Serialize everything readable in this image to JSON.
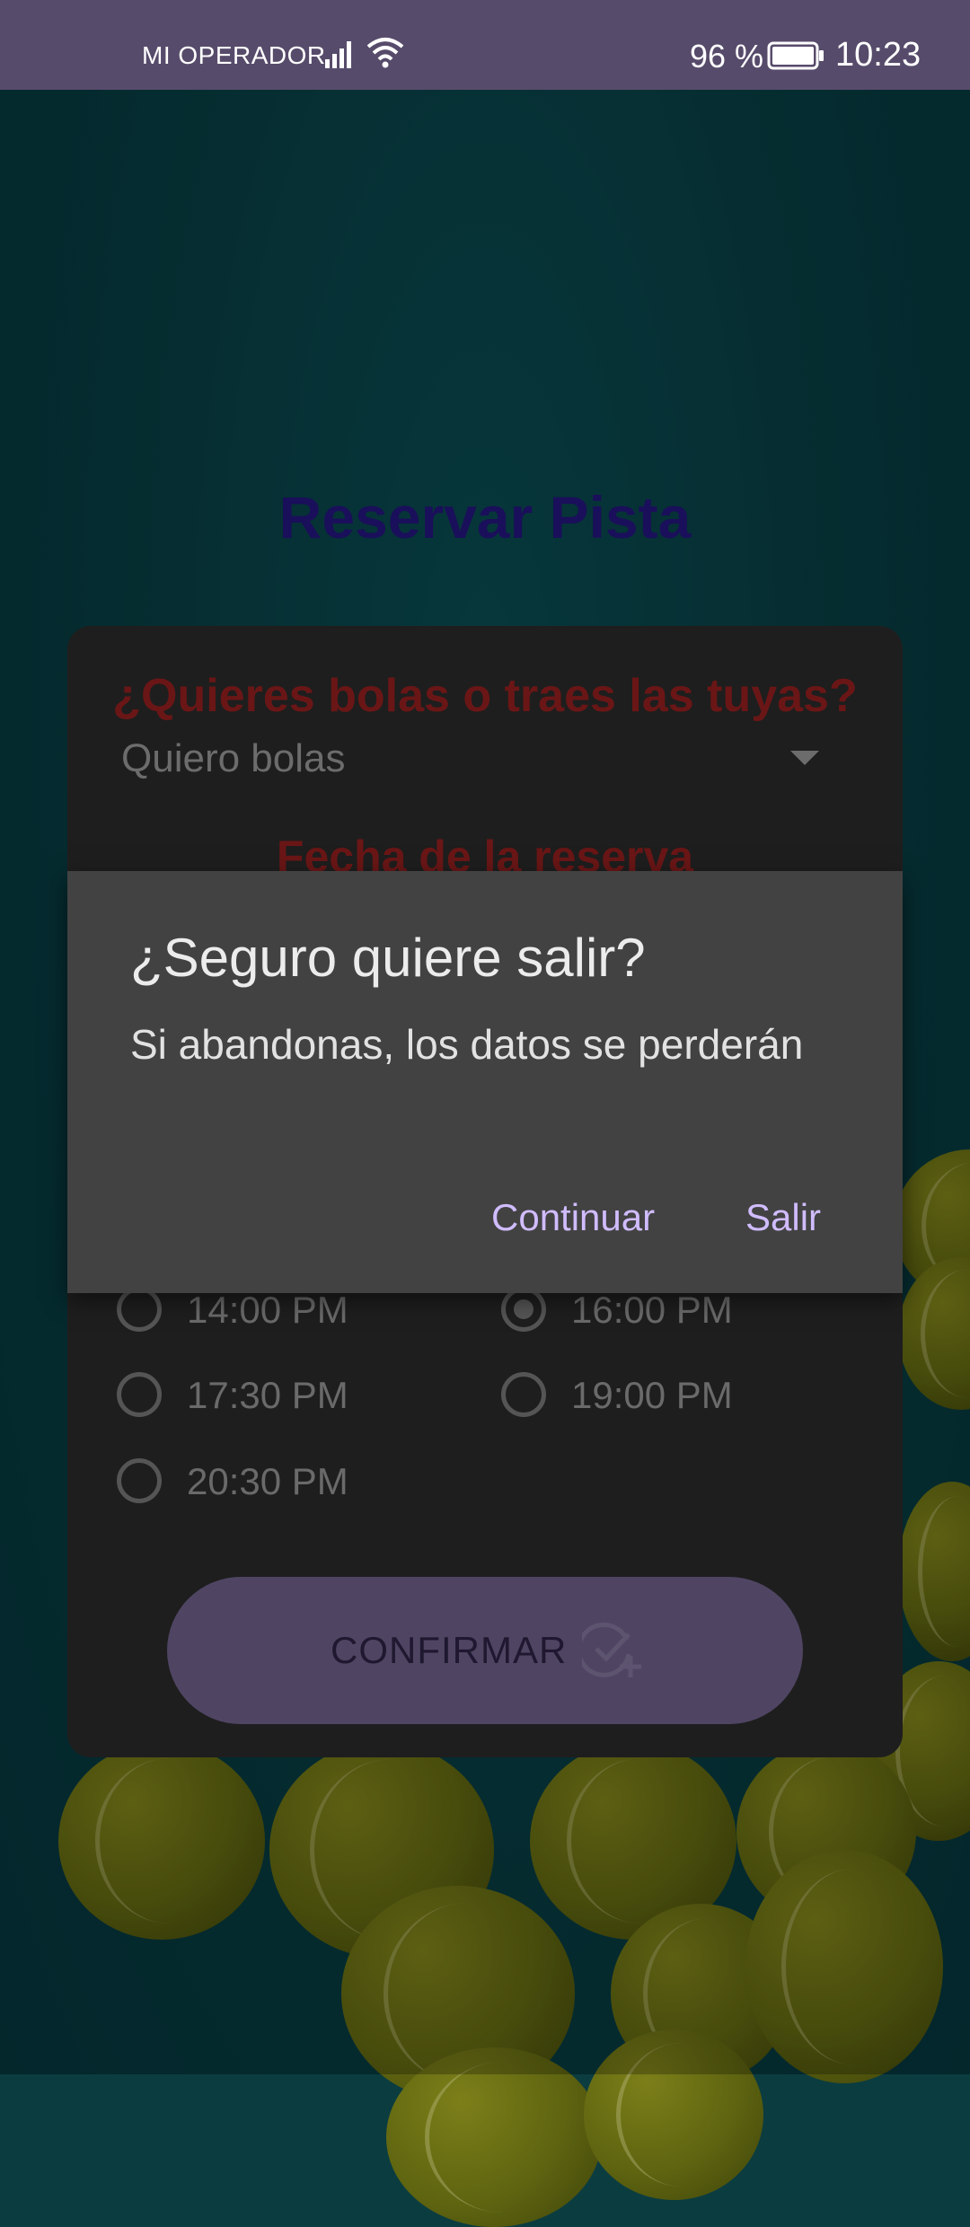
{
  "status_bar": {
    "carrier": "MI OPERADOR",
    "battery_percent": "96 %",
    "time": "10:23"
  },
  "page": {
    "title": "Reservar Pista"
  },
  "form": {
    "balls_question": "¿Quieres bolas o traes las tuyas?",
    "balls_selected": "Quiero bolas",
    "date_heading": "Fecha de la reserva",
    "time_slots": [
      {
        "label": "14:00 PM",
        "checked": false
      },
      {
        "label": "16:00 PM",
        "checked": true
      },
      {
        "label": "17:30 PM",
        "checked": false
      },
      {
        "label": "19:00 PM",
        "checked": false
      },
      {
        "label": "20:30 PM",
        "checked": false
      }
    ],
    "confirm_label": "CONFIRMAR"
  },
  "dialog": {
    "title": "¿Seguro quiere salir?",
    "message": "Si abandonas, los datos se perderán",
    "continue_label": "Continuar",
    "exit_label": "Salir"
  },
  "colors": {
    "status_bar": "#574b6b",
    "dialog_bg": "#424242",
    "dialog_button": "#d0bcff",
    "question_text": "#6a1616"
  },
  "icons": [
    "signal-icon",
    "wifi-icon",
    "battery-icon",
    "check-add-icon",
    "dropdown-arrow-icon"
  ]
}
